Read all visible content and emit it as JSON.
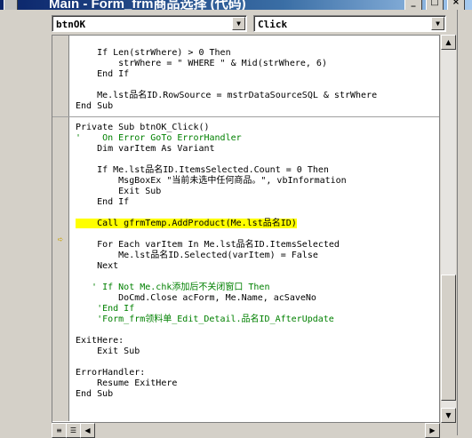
{
  "window": {
    "title": "Main - Form_frm商品选择 (代码)",
    "buttons": [
      "_",
      "□",
      "×"
    ]
  },
  "object_combo": {
    "value": "btnOK"
  },
  "procedure_combo": {
    "value": "Click"
  },
  "code_lines": [
    {
      "text": "    If Len(strWhere) > 0 Then",
      "kind": "code"
    },
    {
      "text": "        strWhere = \" WHERE \" & Mid(strWhere, 6)",
      "kind": "code"
    },
    {
      "text": "    End If",
      "kind": "code"
    },
    {
      "text": "",
      "kind": "code"
    },
    {
      "text": "    Me.lst品名ID.RowSource = mstrDataSourceSQL & strWhere",
      "kind": "code"
    },
    {
      "text": "End Sub",
      "kind": "code"
    },
    {
      "text": "",
      "kind": "separator"
    },
    {
      "text": "Private Sub btnOK_Click()",
      "kind": "code"
    },
    {
      "text": "'    On Error GoTo ErrorHandler",
      "kind": "comment"
    },
    {
      "text": "    Dim varItem As Variant",
      "kind": "code"
    },
    {
      "text": "",
      "kind": "code"
    },
    {
      "text": "    If Me.lst品名ID.ItemsSelected.Count = 0 Then",
      "kind": "code"
    },
    {
      "text": "        MsgBoxEx \"当前未选中任何商品。\", vbInformation",
      "kind": "code"
    },
    {
      "text": "        Exit Sub",
      "kind": "code"
    },
    {
      "text": "    End If",
      "kind": "code"
    },
    {
      "text": "",
      "kind": "code"
    },
    {
      "text": "    Call gfrmTemp.AddProduct(Me.lst品名ID)",
      "kind": "highlight"
    },
    {
      "text": "",
      "kind": "code"
    },
    {
      "text": "    For Each varItem In Me.lst品名ID.ItemsSelected",
      "kind": "code"
    },
    {
      "text": "        Me.lst品名ID.Selected(varItem) = False",
      "kind": "code"
    },
    {
      "text": "    Next",
      "kind": "code"
    },
    {
      "text": "",
      "kind": "code"
    },
    {
      "text": "   ' If Not Me.chk添加后不关闭窗口 Then",
      "kind": "comment"
    },
    {
      "text": "        DoCmd.Close acForm, Me.Name, acSaveNo",
      "kind": "code"
    },
    {
      "text": "    'End If",
      "kind": "comment"
    },
    {
      "text": "    'Form_frm领料单_Edit_Detail.品名ID_AfterUpdate",
      "kind": "comment"
    },
    {
      "text": "",
      "kind": "code"
    },
    {
      "text": "ExitHere:",
      "kind": "code"
    },
    {
      "text": "    Exit Sub",
      "kind": "code"
    },
    {
      "text": "",
      "kind": "code"
    },
    {
      "text": "ErrorHandler:",
      "kind": "code"
    },
    {
      "text": "    Resume ExitHere",
      "kind": "code"
    },
    {
      "text": "End Sub",
      "kind": "code"
    }
  ],
  "colors": {
    "keyword": "#000080",
    "comment": "#008000",
    "highlight": "#ffff00",
    "execution_arrow": "#c8a000"
  },
  "icons": {
    "execution_pointer": "execution-pointer-icon",
    "procedure_view": "procedure-view-icon",
    "full_module_view": "full-module-view-icon"
  }
}
